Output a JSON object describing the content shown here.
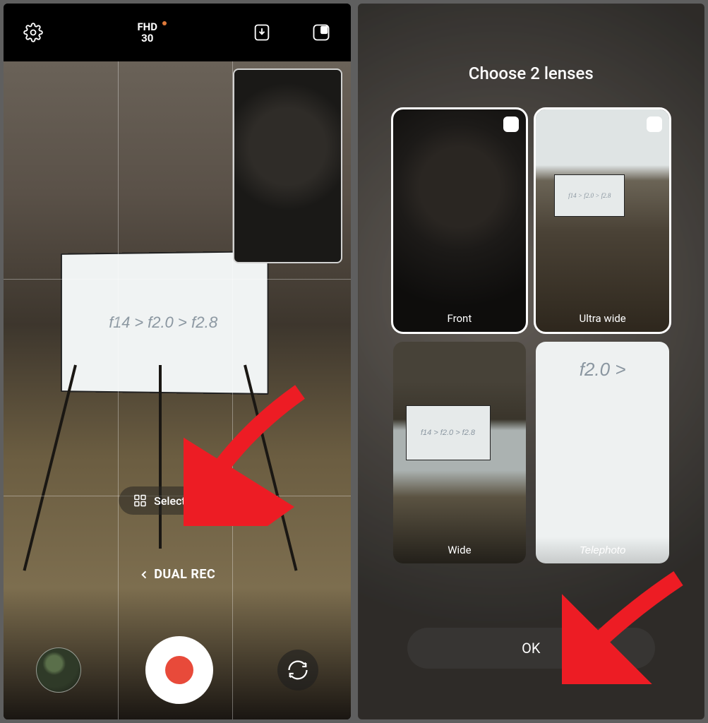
{
  "left": {
    "resolution_main": "FHD",
    "resolution_sub": "30",
    "select_lenses_label": "Select lenses",
    "mode_label": "DUAL REC",
    "whiteboard_text": "f14 > f2.0 > f2.8"
  },
  "right": {
    "title": "Choose 2 lenses",
    "lenses": [
      {
        "label": "Front",
        "selected": true
      },
      {
        "label": "Ultra wide",
        "selected": true
      },
      {
        "label": "Wide",
        "selected": false
      },
      {
        "label": "Telephoto",
        "selected": false
      }
    ],
    "ok_label": "OK",
    "tele_text": "f2.0 >",
    "wide_board_text": "f14 > f2.0 > f2.8",
    "uw_board_text": "f14 > f2.0 > f2.8"
  }
}
